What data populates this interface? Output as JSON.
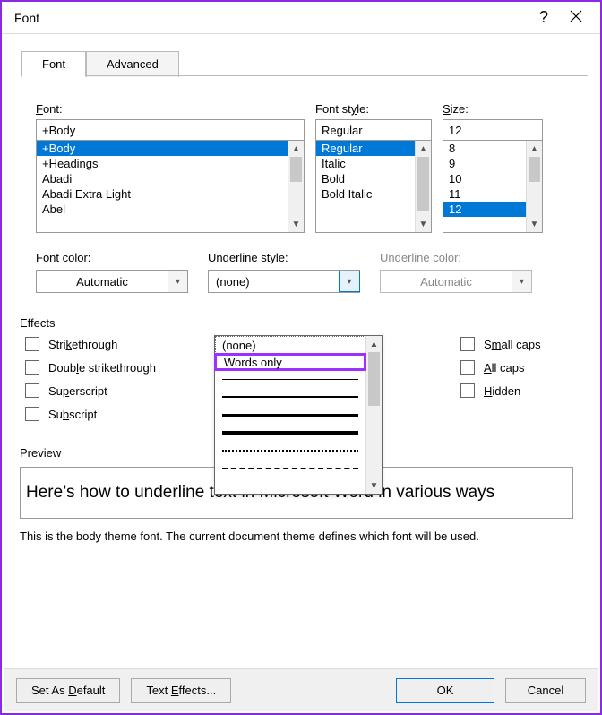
{
  "title": "Font",
  "tabs": {
    "font": "Font",
    "advanced": "Advanced"
  },
  "labels": {
    "font": "Font:",
    "style": "Font style:",
    "size": "Size:",
    "fontColor": "Font color:",
    "underlineStyle": "Underline style:",
    "underlineColor": "Underline color:",
    "effects": "Effects",
    "preview": "Preview"
  },
  "font": {
    "value": "+Body",
    "options": [
      "+Body",
      "+Headings",
      "Abadi",
      "Abadi Extra Light",
      "Abel"
    ],
    "selected": "+Body"
  },
  "style": {
    "value": "Regular",
    "options": [
      "Regular",
      "Italic",
      "Bold",
      "Bold Italic"
    ],
    "selected": "Regular"
  },
  "size": {
    "value": "12",
    "options": [
      "8",
      "9",
      "10",
      "11",
      "12"
    ],
    "selected": "12"
  },
  "fontColor": "Automatic",
  "underlineStyle": {
    "value": "(none)",
    "listText": [
      "(none)",
      "Words only"
    ]
  },
  "underlineColor": "Automatic",
  "effects": {
    "left": [
      "Strikethrough",
      "Double strikethrough",
      "Superscript",
      "Subscript"
    ],
    "right": [
      "Small caps",
      "All caps",
      "Hidden"
    ]
  },
  "preview": {
    "text": "Here’s how to underline text in Microsoft Word in various ways",
    "desc": "This is the body theme font. The current document theme defines which font will be used."
  },
  "buttons": {
    "setDefault": "Set As Default",
    "textEffects": "Text Effects...",
    "ok": "OK",
    "cancel": "Cancel"
  }
}
